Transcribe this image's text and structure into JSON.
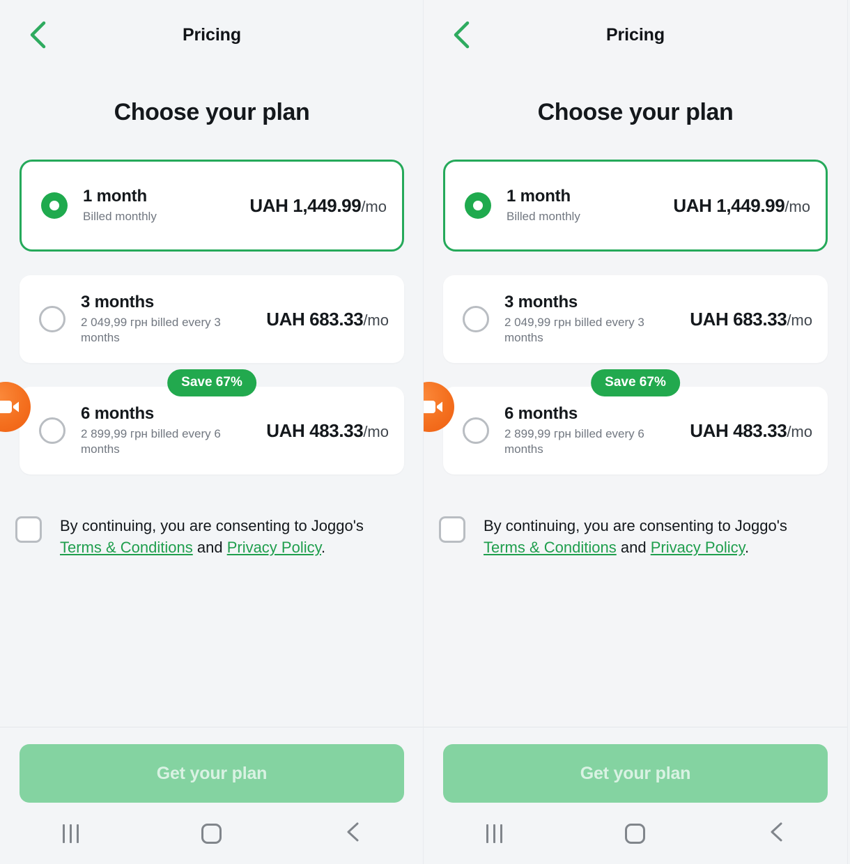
{
  "meta": {
    "app_brand": "Joggo",
    "accent_green": "#1faa4e",
    "badge_green": "#22a94e",
    "link_green": "#1f9e4d",
    "fab_orange": "#f4701f",
    "cta_disabled_green": "#84d3a1",
    "background": "#f3f5f7"
  },
  "screen": {
    "topbar": {
      "back_icon": "chevron-left-icon",
      "title": "Pricing"
    },
    "heading": "Choose your plan",
    "plans": [
      {
        "id": "1-month",
        "title": "1 month",
        "subtitle": "Billed monthly",
        "price": "UAH 1,449.99",
        "price_unit": "/mo",
        "selected": true,
        "badge": null
      },
      {
        "id": "3-months",
        "title": "3 months",
        "subtitle": "2 049,99 грн billed every 3 months",
        "price": "UAH 683.33",
        "price_unit": "/mo",
        "selected": false,
        "badge": null
      },
      {
        "id": "6-months",
        "title": "6 months",
        "subtitle": "2 899,99 грн billed every 6 months",
        "price": "UAH 483.33",
        "price_unit": "/mo",
        "selected": false,
        "badge": "Save 67%"
      }
    ],
    "consent": {
      "checked": false,
      "text_before": "By continuing, you are consenting to Joggo's ",
      "link_terms": "Terms & Conditions",
      "text_middle": " and ",
      "link_privacy": "Privacy Policy",
      "text_after": "."
    },
    "cta": {
      "label": "Get your plan",
      "enabled": false
    },
    "fab": {
      "icon": "video-camera-icon"
    },
    "navbar": {
      "recents": "recents-icon",
      "home": "home-icon",
      "back": "back-icon"
    }
  }
}
